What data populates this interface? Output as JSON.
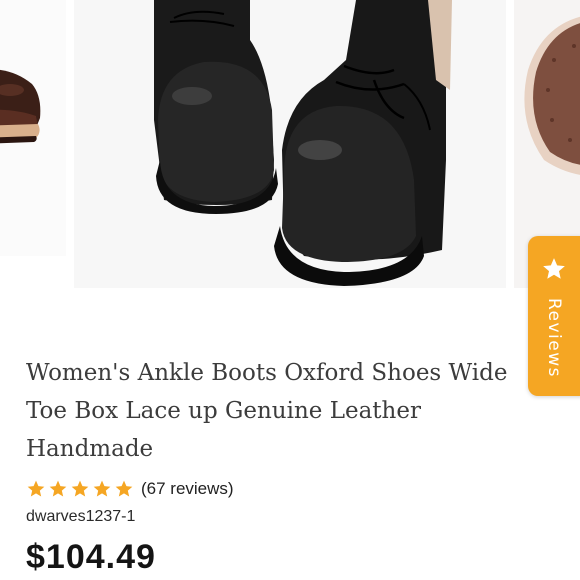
{
  "gallery": {
    "slide_count": 6,
    "active_index": 2,
    "images": [
      "brown-boot-side-photo",
      "black-boots-front-photo",
      "sole-bottom-photo"
    ]
  },
  "reviews_tab": {
    "label": "Reviews",
    "icon": "star-icon",
    "color": "#f5a623"
  },
  "product": {
    "title": "Women's Ankle Boots Oxford Shoes Wide Toe Box Lace up Genuine Leather Handmade",
    "rating": 5,
    "rating_max": 5,
    "review_count_text": "(67 reviews)",
    "sku": "dwarves1237-1",
    "price": "$104.49"
  },
  "colors": {
    "star": "#f5a623",
    "title_text": "#3c3c3c",
    "price_text": "#141414",
    "active_dot": "#111111",
    "inactive_dot": "#8a8a8a"
  }
}
